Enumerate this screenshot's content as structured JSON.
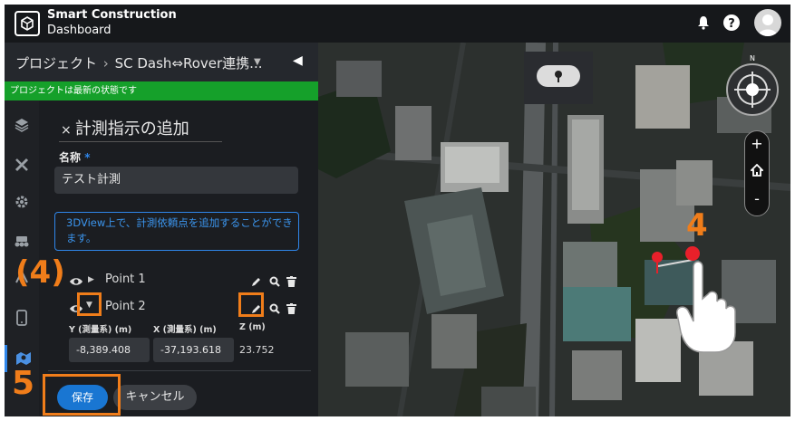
{
  "header": {
    "brand_line1": "Smart Construction",
    "brand_line2": "Dashboard",
    "icons": [
      "bell-icon",
      "help-icon",
      "user-avatar"
    ]
  },
  "project_bar": {
    "label": "プロジェクト",
    "separator": "›",
    "project_name": "SC Dash⇔Rover連携...",
    "status": "プロジェクトは最新の状態です"
  },
  "rail": {
    "icons": [
      "layers-icon",
      "survey-tools-icon",
      "settings-gear-icon",
      "machine-icon",
      "route-icon",
      "tablet-icon",
      "measurement-icon"
    ],
    "active_index": 6
  },
  "panel": {
    "close_symbol": "×",
    "title": "計測指示の追加",
    "name_label": "名称",
    "required_mark": "*",
    "name_value": "テスト計測",
    "info_text": "3DView上で、計測依頼点を追加することができます。",
    "points": [
      {
        "label": "Point 1",
        "expanded": false
      },
      {
        "label": "Point 2",
        "expanded": true
      }
    ],
    "coords": {
      "y_label": "Y (測量系) (m)",
      "x_label": "X (測量系) (m)",
      "z_label": "Z (m)",
      "y_value": "-8,389.408",
      "x_value": "-37,193.618",
      "z_value": "23.752"
    },
    "save_label": "保存",
    "cancel_label": "キャンセル"
  },
  "map": {
    "compass_label": "N",
    "zoom_in": "+",
    "zoom_out": "-",
    "home_icon": "home-icon"
  },
  "annotations": {
    "step4_map": "4",
    "step4_panel": "(4)",
    "step5": "5"
  },
  "colors": {
    "accent": "#2f86ea",
    "status_green": "#15a02a",
    "annotation_orange": "#f07d1a",
    "marker_red": "#e8202a"
  }
}
